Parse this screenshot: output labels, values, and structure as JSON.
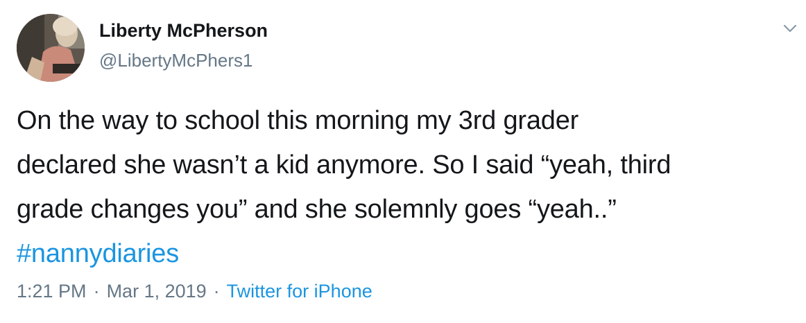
{
  "author": {
    "display_name": "Liberty McPherson",
    "handle": "@LibertyMcPhers1"
  },
  "tweet": {
    "lines": [
      "On the way to school this morning my 3rd grader",
      "declared she wasn’t a kid anymore. So I said “yeah, third",
      "grade changes you” and she solemnly goes “yeah..”"
    ],
    "hashtag": "#nannydiaries"
  },
  "meta": {
    "time": "1:21 PM",
    "separator": "·",
    "date": "Mar 1, 2019",
    "source": "Twitter for iPhone"
  },
  "icons": {
    "more_menu": "chevron-down-icon"
  },
  "colors": {
    "text": "#14171a",
    "secondary": "#657786",
    "link": "#1b95e0"
  }
}
